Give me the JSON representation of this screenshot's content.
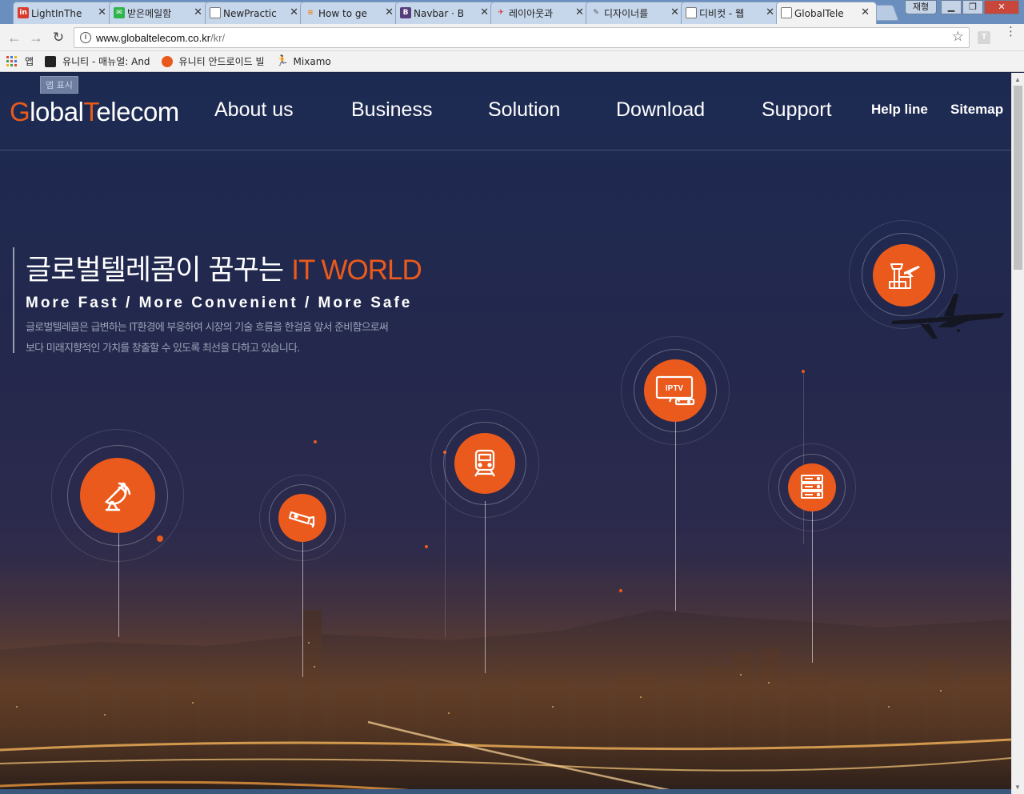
{
  "browser": {
    "tabs": [
      {
        "title": "LightInThe",
        "favicon": "linkedin-icon",
        "color": "#d93b2f"
      },
      {
        "title": "받은메일함",
        "favicon": "mail-icon",
        "color": "#2fb34a"
      },
      {
        "title": "NewPractic",
        "favicon": "page-icon",
        "color": ""
      },
      {
        "title": "How to ge",
        "favicon": "stackoverflow-icon",
        "color": "#f2811f"
      },
      {
        "title": "Navbar · B",
        "favicon": "bootstrap-icon",
        "color": "#563d7c"
      },
      {
        "title": "레이아웃과",
        "favicon": "bird-icon",
        "color": "#d5252a"
      },
      {
        "title": "디자이너를",
        "favicon": "pen-icon",
        "color": ""
      },
      {
        "title": "디비컷 - 웹",
        "favicon": "page-icon",
        "color": ""
      },
      {
        "title": "GlobalTele",
        "favicon": "page-icon",
        "color": "",
        "active": true
      }
    ],
    "profile_label": "재형",
    "url_host": "www.globaltelecom.co.kr",
    "url_path": "/kr/",
    "extension_label": "T",
    "bookmarks": [
      {
        "label": "앱",
        "icon": "apps-grid-icon"
      },
      {
        "label": "유니티 - 매뉴얼: And",
        "icon": "unity-icon"
      },
      {
        "label": "유니티 안드로이드 빌",
        "icon": "unity-android-icon"
      },
      {
        "label": "Mixamo",
        "icon": "mixamo-icon"
      }
    ],
    "tooltip": "앱 표시"
  },
  "site": {
    "logo": {
      "g": "G",
      "lobal": "lobal",
      "t": "T",
      "elecom": "elecom"
    },
    "nav": [
      "About us",
      "Business",
      "Solution",
      "Download",
      "Support"
    ],
    "util_nav": [
      "Help line",
      "Sitemap"
    ],
    "hero": {
      "title_main": "글로벌텔레콤이 꿈꾸는 ",
      "title_accent": "IT WORLD",
      "subtitle": "More Fast / More Convenient / More Safe",
      "desc_line1": "글로벌텔레콤은 급변하는 IT환경에 부응하여 시장의 기술 흐름을 한걸음 앞서 준비함으로써",
      "desc_line2": "보다 미래지향적인 가치를 창출할 수 있도록 최선을 다하고 있습니다."
    },
    "nodes": [
      {
        "name": "satellite-dish-icon"
      },
      {
        "name": "cctv-camera-icon"
      },
      {
        "name": "train-icon"
      },
      {
        "name": "iptv-icon",
        "label": "IPTV"
      },
      {
        "name": "server-rack-icon"
      },
      {
        "name": "airport-tower-icon"
      }
    ],
    "accent_color": "#ea5a1c"
  }
}
